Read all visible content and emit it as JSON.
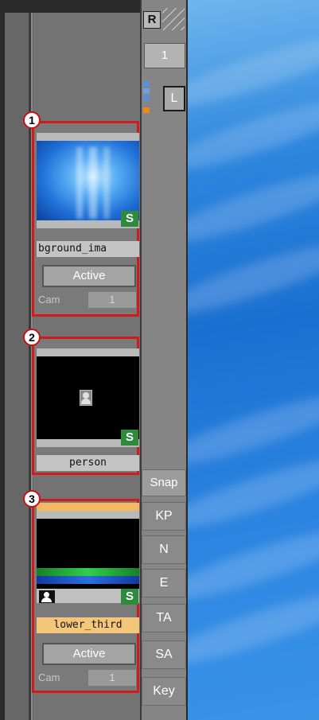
{
  "toolbar": {
    "r_label": "R",
    "layer_number": "1",
    "lock_label": "L"
  },
  "side_buttons": [
    {
      "label": "Snap"
    },
    {
      "label": "KP"
    },
    {
      "label": "N"
    },
    {
      "label": "E"
    },
    {
      "label": "TA"
    },
    {
      "label": "SA"
    },
    {
      "label": "Key"
    }
  ],
  "layers": [
    {
      "badge": "1",
      "name": "bground_ima",
      "status": "Active",
      "cam_label": "Cam",
      "cam_value": "1",
      "s_label": "S"
    },
    {
      "badge": "2",
      "name": "person",
      "s_label": "S"
    },
    {
      "badge": "3",
      "name": "lower_third",
      "status": "Active",
      "cam_label": "Cam",
      "cam_value": "1",
      "s_label": "S"
    }
  ],
  "colors": {
    "highlight_border": "#d21a1a",
    "s_badge": "#2e8b3e",
    "lower_third_name_bg": "#f4c67a"
  }
}
